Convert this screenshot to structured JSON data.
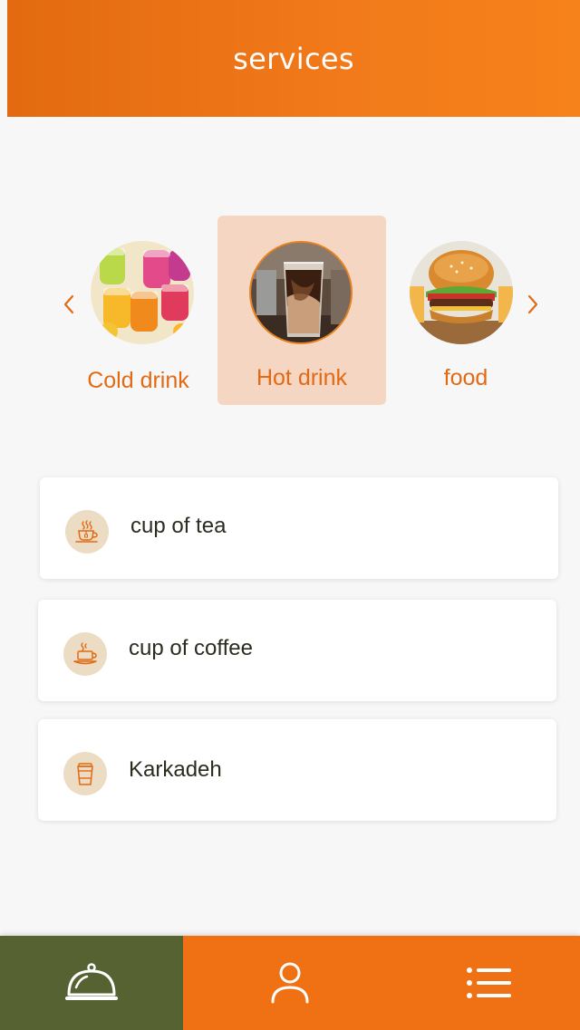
{
  "header": {
    "title": "services"
  },
  "categories": [
    {
      "label": "Cold drink",
      "icon": "cold-drink-image",
      "selected": false
    },
    {
      "label": "Hot drink",
      "icon": "hot-drink-image",
      "selected": true
    },
    {
      "label": "food",
      "icon": "food-image",
      "selected": false
    }
  ],
  "items": [
    {
      "label": "cup of tea",
      "icon": "tea-cup-icon"
    },
    {
      "label": "cup of coffee",
      "icon": "coffee-cup-icon"
    },
    {
      "label": "Karkadeh",
      "icon": "paper-cup-icon"
    }
  ],
  "nav": [
    {
      "name": "services",
      "icon": "cloche-icon",
      "active": true
    },
    {
      "name": "profile",
      "icon": "user-icon",
      "active": false
    },
    {
      "name": "menu",
      "icon": "list-icon",
      "active": false
    }
  ],
  "colors": {
    "accent": "#f07014",
    "active_nav": "#566232",
    "selected_category": "#f5d6c2",
    "label": "#e26a14",
    "icon_bg": "#ecdcc4"
  }
}
